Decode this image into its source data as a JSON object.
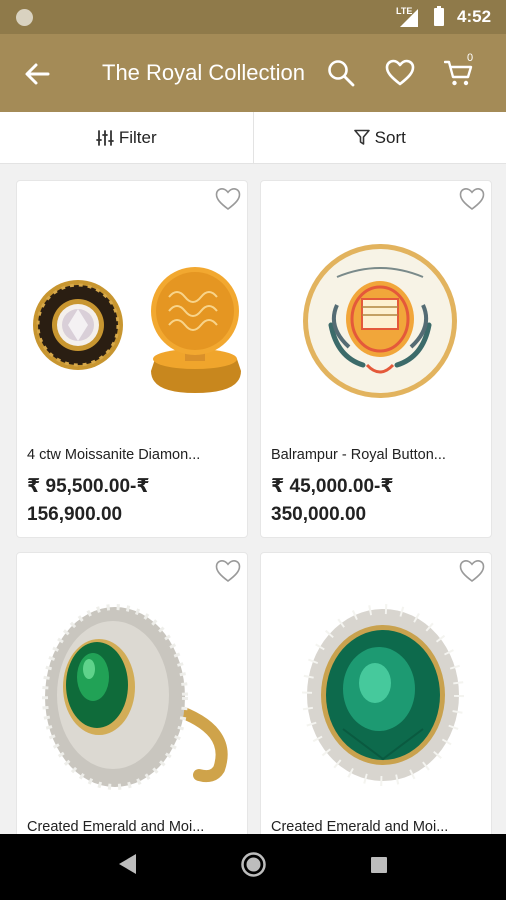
{
  "status": {
    "network": "LTE",
    "time": "4:52"
  },
  "header": {
    "title": "The Royal Collection",
    "cart_count": "0"
  },
  "toolbar": {
    "filter_label": "Filter",
    "sort_label": "Sort"
  },
  "products": [
    {
      "name": "4 ctw Moissanite Diamon...",
      "price": "₹ 95,500.00-₹ 156,900.00"
    },
    {
      "name": "Balrampur - Royal Button...",
      "price": "₹ 45,000.00-₹ 350,000.00"
    },
    {
      "name": "Created Emerald and Moi...",
      "price": ""
    },
    {
      "name": "Created Emerald and Moi...",
      "price": ""
    }
  ],
  "colors": {
    "header": "#a48b57",
    "statusbar": "#8f7a4a"
  }
}
